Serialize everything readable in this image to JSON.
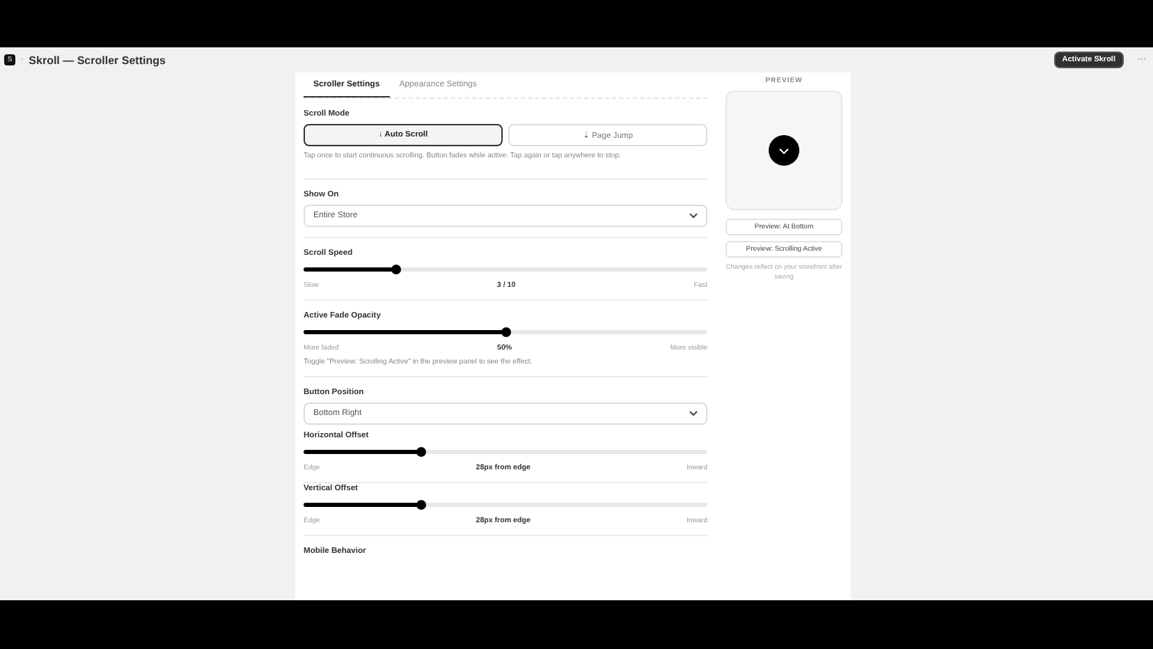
{
  "header": {
    "app_icon": "S",
    "separator": "›",
    "title": "Skroll — Scroller Settings",
    "activate_button": "Activate Skroll",
    "more": "···"
  },
  "tabs": [
    {
      "label": "Scroller Settings",
      "selected": true
    },
    {
      "label": "Appearance Settings",
      "selected": false
    }
  ],
  "scroll_mode": {
    "label": "Scroll Mode",
    "options": [
      {
        "label": "↓ Auto Scroll",
        "selected": true
      },
      {
        "label": "⇣ Page Jump",
        "selected": false
      }
    ],
    "hint": "Tap once to start continuous scrolling. Button fades while active. Tap again or tap anywhere to stop."
  },
  "show_on": {
    "label": "Show On",
    "value": "Entire Store"
  },
  "scroll_speed": {
    "label": "Scroll Speed",
    "level": 0.23,
    "min_label": "Slow",
    "reading": "3 / 10",
    "max_label": "Fast"
  },
  "fade_opacity": {
    "label": "Active Fade Opacity",
    "level": 0.5,
    "min_label": "More faded",
    "reading": "50%",
    "max_label": "More visible",
    "hint": "Toggle \"Preview: Scrolling Active\" in the preview panel to see the effect."
  },
  "button_position": {
    "label": "Button Position",
    "value": "Bottom Right"
  },
  "horizontal_offset": {
    "label": "Horizontal Offset",
    "level": 0.29,
    "min_label": "Edge",
    "reading": "28px from edge",
    "max_label": "Inward"
  },
  "vertical_offset": {
    "label": "Vertical Offset",
    "level": 0.29,
    "min_label": "Edge",
    "reading": "28px from edge",
    "max_label": "Inward"
  },
  "mobile_behavior": {
    "label": "Mobile Behavior"
  },
  "preview": {
    "title": "PREVIEW",
    "buttons": [
      "Preview: At Bottom",
      "Preview: Scrolling Active"
    ],
    "note": "Changes reflect on your storefront after saving"
  }
}
